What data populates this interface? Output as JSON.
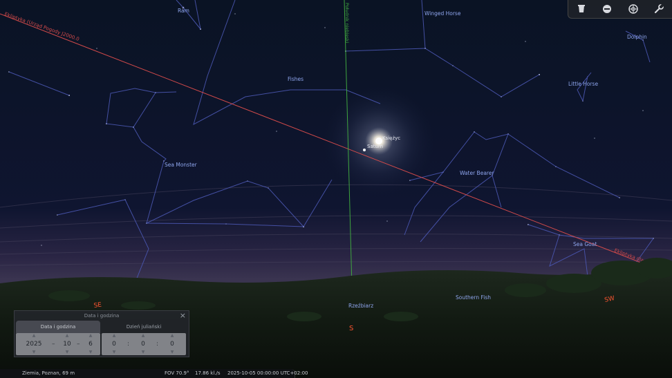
{
  "sky": {
    "constellations": {
      "ram": "Ram",
      "winged_horse": "Winged Horse",
      "dolphin": "Dolphin",
      "fishes": "Fishes",
      "little_horse": "Little Horse",
      "sea_monster": "Sea Monster",
      "water_bearer": "Water Bearer",
      "sea_goat": "Sea Goat",
      "rzezbiarz": "Rzeźbiarz",
      "southern_fish": "Southern Fish"
    },
    "objects": {
      "moon": "Księżyc",
      "saturn": "Saturn"
    },
    "lines": {
      "ecliptic_left": "Ekliptyka (Urząd Pogody J2000.0",
      "ecliptic_right": "Ekliptyka dla ep",
      "meridian": "Południk niebieski"
    },
    "cardinals": {
      "se": "SE",
      "s": "S",
      "sw": "SW"
    },
    "colors": {
      "sky_top": "#0b1426",
      "constellation_line": "#4a56b0",
      "constellation_label": "#8fa6ee",
      "ecliptic": "#d24a4a",
      "meridian": "#3fa63f",
      "cardinal": "#ff5530"
    }
  },
  "toolbar": {
    "buttons": [
      {
        "name": "view-icon"
      },
      {
        "name": "panel-icon"
      },
      {
        "name": "sky-icon"
      },
      {
        "name": "wrench-icon"
      }
    ]
  },
  "dialog": {
    "title": "Data i godzina",
    "close": "×",
    "tabs": [
      "Data i godzina",
      "Dzień juliański"
    ],
    "date": {
      "year": "2025",
      "month": "10",
      "day": "6"
    },
    "time": {
      "hour": "0",
      "minute": "0",
      "second": "0"
    },
    "dash": "–",
    "colon": ":",
    "arrow_up": "▲",
    "arrow_down": "▼"
  },
  "status": {
    "location": "Ziemia, Poznan, 69 m",
    "fov": "FOV 70.9°",
    "fps": "17.86 kl./s",
    "datetime": "2025-10-05 00:00:00 UTC+02:00"
  }
}
